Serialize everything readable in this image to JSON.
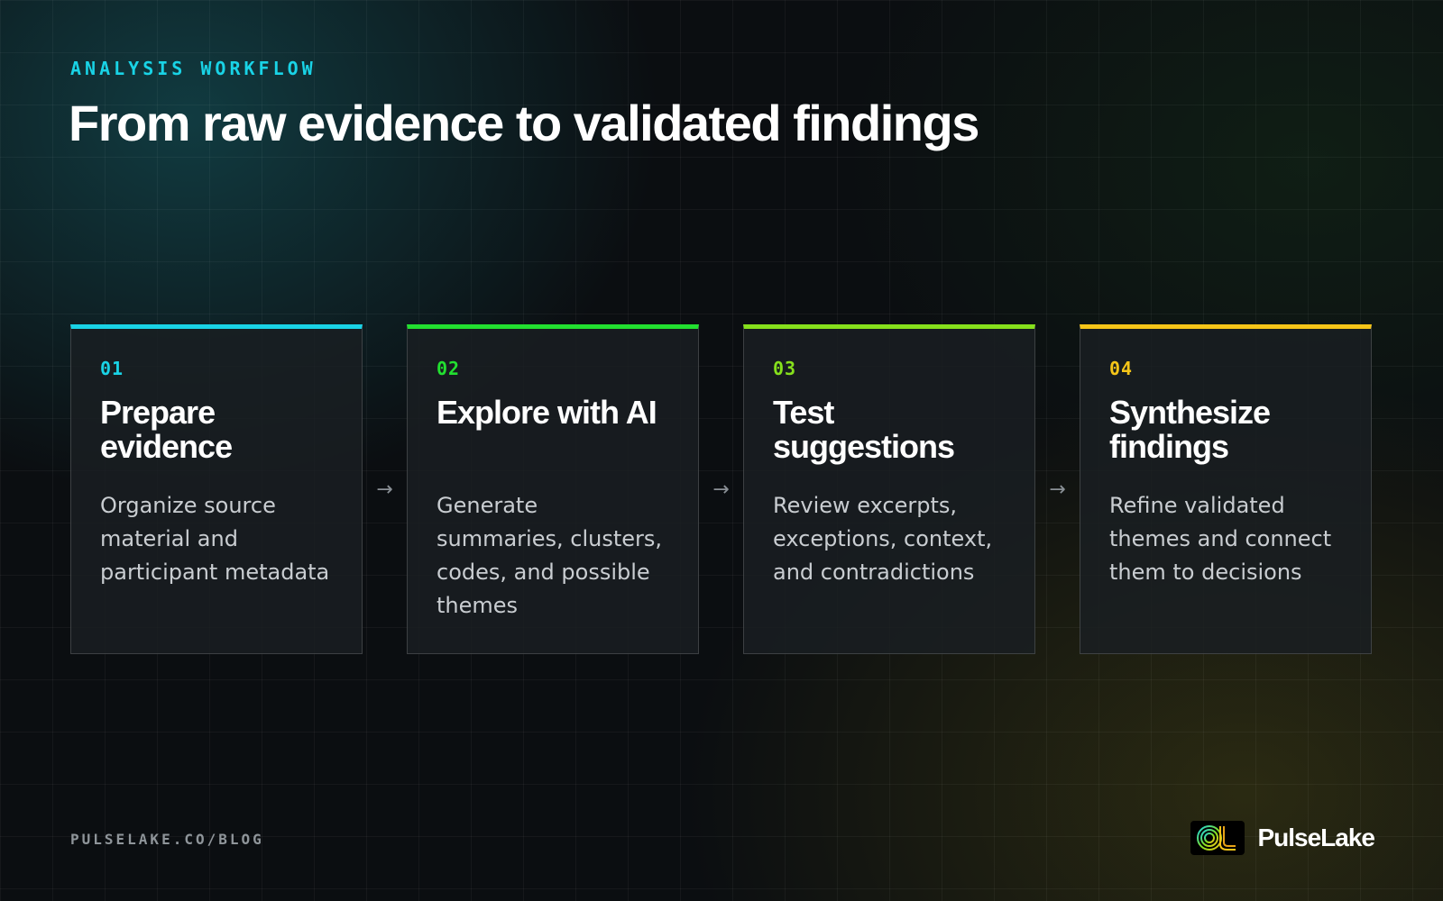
{
  "header": {
    "eyebrow": "ANALYSIS WORKFLOW",
    "title": "From raw evidence to validated findings"
  },
  "steps": [
    {
      "number": "01",
      "title": "Prepare evidence",
      "description": "Organize source material and participant metadata",
      "accent": "#19d3e6"
    },
    {
      "number": "02",
      "title": "Explore with AI",
      "description": "Generate summaries, clusters, codes, and possible themes",
      "accent": "#22e030"
    },
    {
      "number": "03",
      "title": "Test suggestions",
      "description": "Review excerpts, exceptions, context, and contradictions",
      "accent": "#86e01c"
    },
    {
      "number": "04",
      "title": "Synthesize findings",
      "description": "Refine validated themes and connect them to decisions",
      "accent": "#f5c518"
    }
  ],
  "connector": {
    "arrow": "→",
    "icon": "arrow-right-icon"
  },
  "footer": {
    "url": "PULSELAKE.CO/BLOG",
    "brand_name": "PulseLake",
    "logo_icon": "pulselake-logo-icon"
  }
}
